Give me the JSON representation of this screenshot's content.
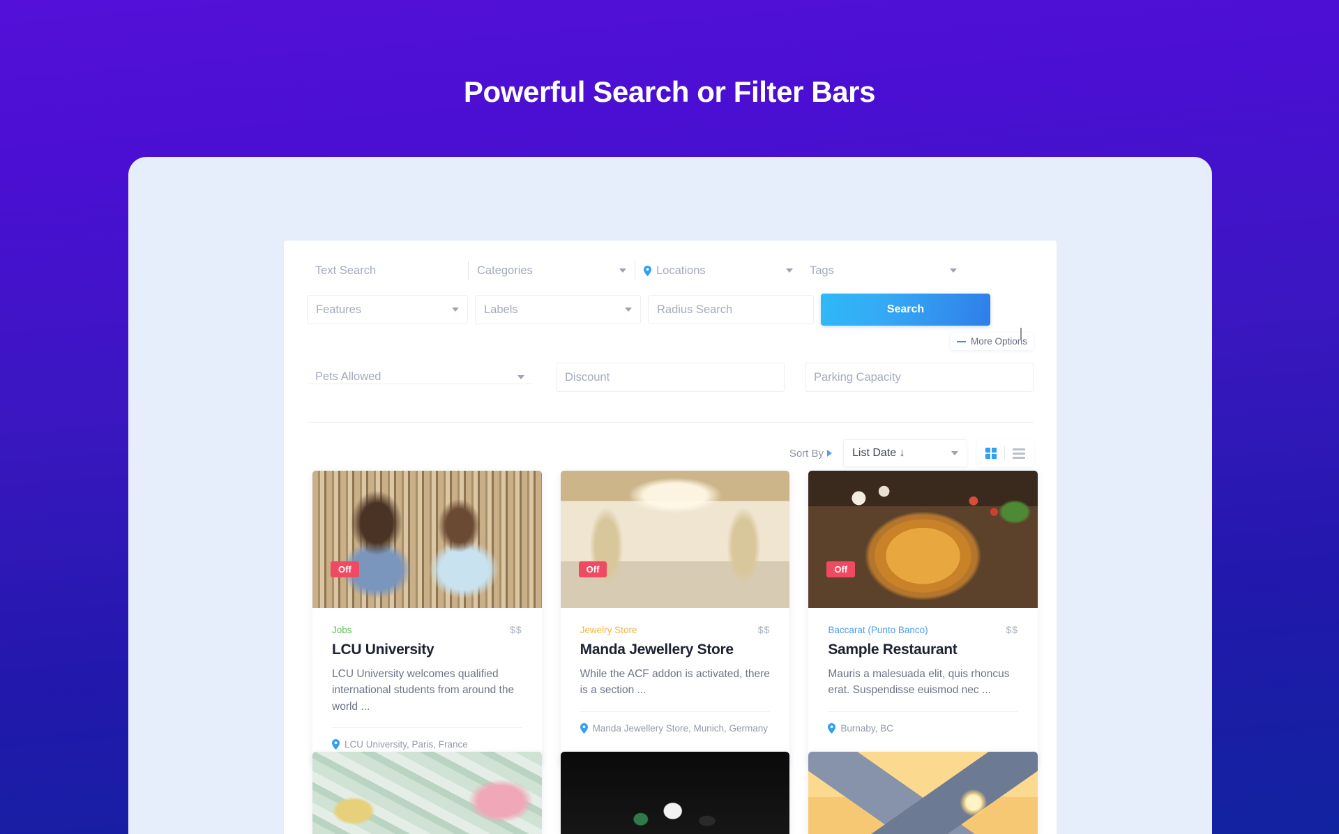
{
  "header": {
    "title": "Powerful Search or Filter Bars"
  },
  "search": {
    "text_search_placeholder": "Text Search",
    "categories_placeholder": "Categories",
    "locations_placeholder": "Locations",
    "tags_placeholder": "Tags",
    "features_placeholder": "Features",
    "labels_placeholder": "Labels",
    "radius_placeholder": "Radius Search",
    "search_button": "Search",
    "more_options": "More Options"
  },
  "extra_filters": {
    "pets_allowed": "Pets Allowed",
    "discount": "Discount",
    "parking_capacity": "Parking Capacity"
  },
  "sort": {
    "label": "Sort By",
    "selected": "List Date ↓",
    "grid_view_icon": "grid-view-icon",
    "list_view_icon": "list-view-icon"
  },
  "listings": [
    {
      "badge": "Off",
      "category": "Jobs",
      "category_color": "#5bbf58",
      "price": "$$",
      "title": "LCU University",
      "description": "LCU University welcomes qualified international students from around the world ...",
      "location": "LCU University, Paris, France",
      "image": "students-reading-in-library"
    },
    {
      "badge": "Off",
      "category": "Jewelry Store",
      "category_color": "#f3b63c",
      "price": "$$",
      "title": "Manda Jewellery Store",
      "description": "While the ACF addon is activated, there is a section ...",
      "location": "Manda Jewellery Store, Munich, Germany",
      "image": "cartier-storefront"
    },
    {
      "badge": "Off",
      "category": "Baccarat (Punto Banco)",
      "category_color": "#4a9cf0",
      "price": "$$",
      "title": "Sample Restaurant",
      "description": "Mauris a malesuada elit, quis rhoncus erat. Suspendisse euismod nec ...",
      "location": "Burnaby, BC",
      "image": "pizza-on-wooden-board"
    }
  ],
  "listings_row2": [
    {
      "image": "banknotes-and-coins"
    },
    {
      "image": "casino-dice-dark"
    },
    {
      "image": "sunset-pyramid"
    }
  ],
  "colors": {
    "background_top": "#5410d8",
    "background_bottom": "#11239f",
    "panel": "#e6eefb",
    "accent_blue": "#2f8ef4",
    "badge_red": "#f04a63"
  }
}
